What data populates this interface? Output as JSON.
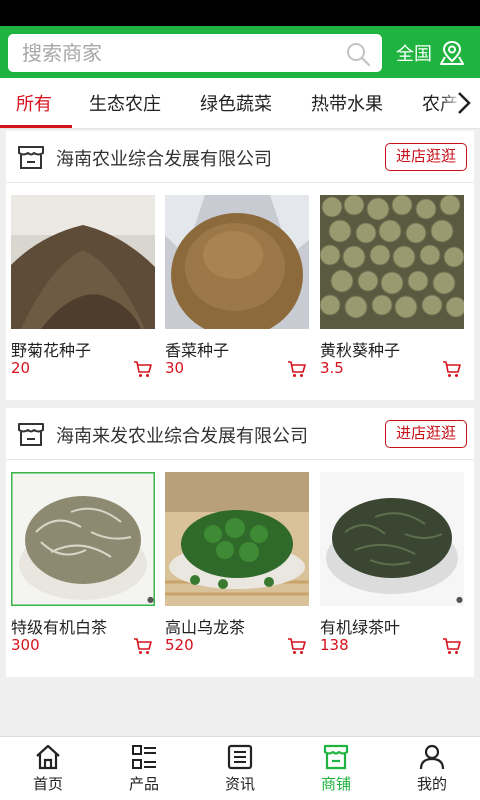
{
  "search": {
    "placeholder": "搜索商家"
  },
  "region": {
    "label": "全国"
  },
  "tabs": [
    {
      "label": "所有",
      "active": true
    },
    {
      "label": "生态农庄"
    },
    {
      "label": "绿色蔬菜"
    },
    {
      "label": "热带水果"
    },
    {
      "label": "农产"
    }
  ],
  "shops": [
    {
      "name": "海南农业综合发展有限公司",
      "button": "进店逛逛",
      "products": [
        {
          "name": "野菊花种子",
          "price": "20"
        },
        {
          "name": "香菜种子",
          "price": "30"
        },
        {
          "name": "黄秋葵种子",
          "price": "3.5"
        }
      ]
    },
    {
      "name": "海南来发农业综合发展有限公司",
      "button": "进店逛逛",
      "products": [
        {
          "name": "特级有机白茶",
          "price": "300"
        },
        {
          "name": "高山乌龙茶",
          "price": "520"
        },
        {
          "name": "有机绿茶叶",
          "price": "138"
        }
      ]
    }
  ],
  "nav": [
    {
      "label": "首页",
      "icon": "home-icon"
    },
    {
      "label": "产品",
      "icon": "product-icon"
    },
    {
      "label": "资讯",
      "icon": "news-icon"
    },
    {
      "label": "商铺",
      "icon": "store-icon",
      "active": true
    },
    {
      "label": "我的",
      "icon": "user-icon"
    }
  ],
  "colors": {
    "brand": "#1fb43f",
    "accent": "#d6121d"
  }
}
